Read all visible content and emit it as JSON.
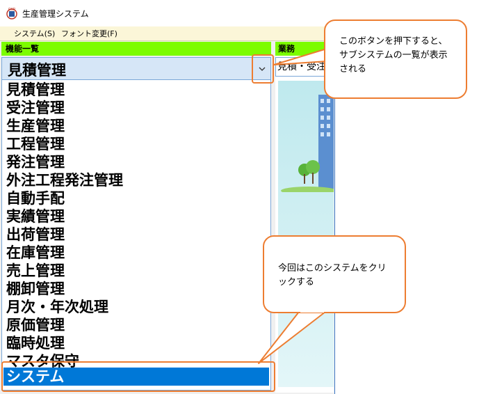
{
  "window": {
    "title": "生産管理システム",
    "menu": [
      {
        "label": "システム(S)"
      },
      {
        "label": "フォント変更(F)"
      }
    ]
  },
  "left_panel": {
    "header": "機能一覧",
    "combo_value": "見積管理",
    "items": [
      {
        "label": "見積管理"
      },
      {
        "label": "受注管理"
      },
      {
        "label": "生産管理"
      },
      {
        "label": "工程管理"
      },
      {
        "label": "発注管理"
      },
      {
        "label": "外注工程発注管理"
      },
      {
        "label": "自動手配"
      },
      {
        "label": "実績管理"
      },
      {
        "label": "出荷管理"
      },
      {
        "label": "在庫管理"
      },
      {
        "label": "売上管理"
      },
      {
        "label": "棚卸管理"
      },
      {
        "label": "月次・年次処理"
      },
      {
        "label": "原価管理"
      },
      {
        "label": "臨時処理"
      },
      {
        "label": "マスタ保守"
      },
      {
        "label": "システム"
      }
    ],
    "selected_item": "システム"
  },
  "right_panel": {
    "header": "業務",
    "field_value": "見積・受注"
  },
  "callouts": {
    "button_note": "このボタンを押下すると、サブシステムの一覧が表示される",
    "system_note": "今回はこのシステムをクリックする"
  },
  "colors": {
    "header_green": "#7cfc00",
    "selection_blue": "#0078d7",
    "callout_orange": "#ed7d31",
    "menubar_yellow": "#fbf6d8"
  },
  "icons": {
    "app": "app-logo-icon",
    "dropdown": "chevron-down-icon"
  }
}
